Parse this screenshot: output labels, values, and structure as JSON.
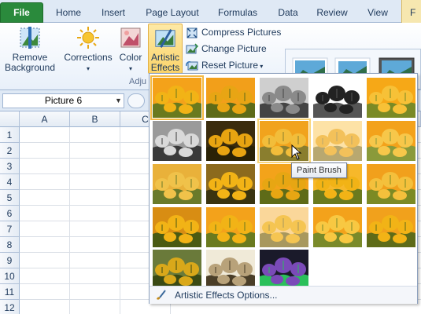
{
  "tabs": [
    {
      "label": "File"
    },
    {
      "label": "Home"
    },
    {
      "label": "Insert"
    },
    {
      "label": "Page Layout"
    },
    {
      "label": "Formulas"
    },
    {
      "label": "Data"
    },
    {
      "label": "Review"
    },
    {
      "label": "View"
    },
    {
      "label": "F"
    }
  ],
  "ribbon": {
    "remove_background": {
      "line1": "Remove",
      "line2": "Background"
    },
    "corrections": "Corrections",
    "color": "Color",
    "artistic_effects": {
      "line1": "Artistic",
      "line2": "Effects"
    },
    "compress_pictures": "Compress Pictures",
    "change_picture": "Change Picture",
    "reset_picture": "Reset Picture",
    "group_label": "Adju"
  },
  "formula_bar": {
    "name_box": "Picture 6"
  },
  "columns": [
    "A",
    "B",
    "C"
  ],
  "rows": [
    "1",
    "2",
    "3",
    "4",
    "5",
    "6",
    "7",
    "8",
    "9",
    "10",
    "11",
    "12"
  ],
  "gallery": {
    "effects_count": 23,
    "selected_index": 0,
    "hover_index": 7,
    "options_label": "Artistic Effects Options..."
  },
  "tooltip": "Paint Brush",
  "colors": {
    "file_tab": "#2a8a3c",
    "highlight": "#fbd46a",
    "tulip": "#f2b316"
  }
}
